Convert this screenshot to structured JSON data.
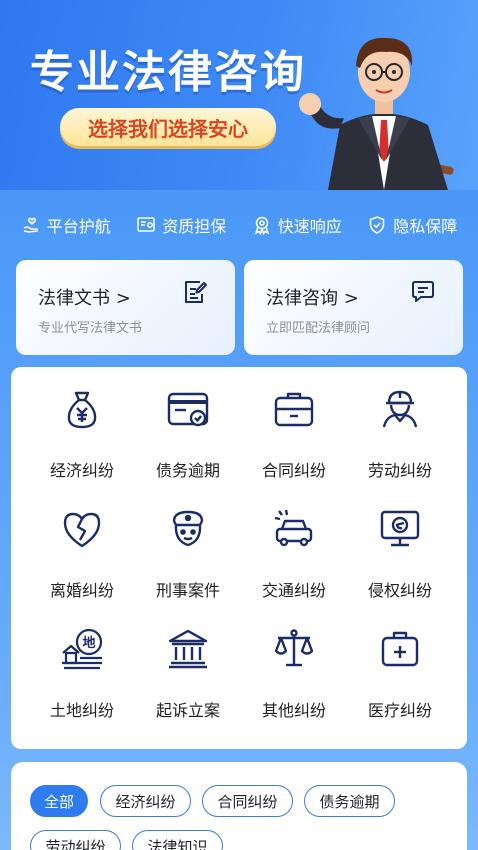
{
  "banner": {
    "title": "专业法律咨询",
    "slogan": "选择我们选择安心"
  },
  "features": [
    {
      "icon": "hand-heart-icon",
      "label": "平台护航"
    },
    {
      "icon": "certificate-icon",
      "label": "资质担保"
    },
    {
      "icon": "badge-icon",
      "label": "快速响应"
    },
    {
      "icon": "shield-check-icon",
      "label": "隐私保障"
    }
  ],
  "services": [
    {
      "title": "法律文书 >",
      "subtitle": "专业代写法律文书",
      "icon": "document-edit-icon"
    },
    {
      "title": "法律咨询 >",
      "subtitle": "立即匹配法律顾问",
      "icon": "chat-bubble-icon"
    }
  ],
  "categories": [
    {
      "label": "经济纠纷",
      "icon": "money-bag-icon"
    },
    {
      "label": "债务逾期",
      "icon": "card-clock-icon"
    },
    {
      "label": "合同纠纷",
      "icon": "briefcase-icon"
    },
    {
      "label": "劳动纠纷",
      "icon": "worker-helmet-icon"
    },
    {
      "label": "离婚纠纷",
      "icon": "broken-heart-icon"
    },
    {
      "label": "刑事案件",
      "icon": "police-icon"
    },
    {
      "label": "交通纠纷",
      "icon": "car-crash-icon"
    },
    {
      "label": "侵权纠纷",
      "icon": "monitor-icon"
    },
    {
      "label": "土地纠纷",
      "icon": "land-house-icon"
    },
    {
      "label": "起诉立案",
      "icon": "courthouse-icon"
    },
    {
      "label": "其他纠纷",
      "icon": "scales-icon"
    },
    {
      "label": "医疗纠纷",
      "icon": "medical-kit-icon"
    }
  ],
  "filters": [
    {
      "label": "全部",
      "active": true
    },
    {
      "label": "经济纠纷",
      "active": false
    },
    {
      "label": "合同纠纷",
      "active": false
    },
    {
      "label": "债务逾期",
      "active": false
    },
    {
      "label": "劳动纠纷",
      "active": false
    },
    {
      "label": "法律知识",
      "active": false
    }
  ],
  "colors": {
    "primary": "#2e7cf0",
    "icon_navy": "#1c2c66",
    "pill_text": "#d9461f"
  }
}
